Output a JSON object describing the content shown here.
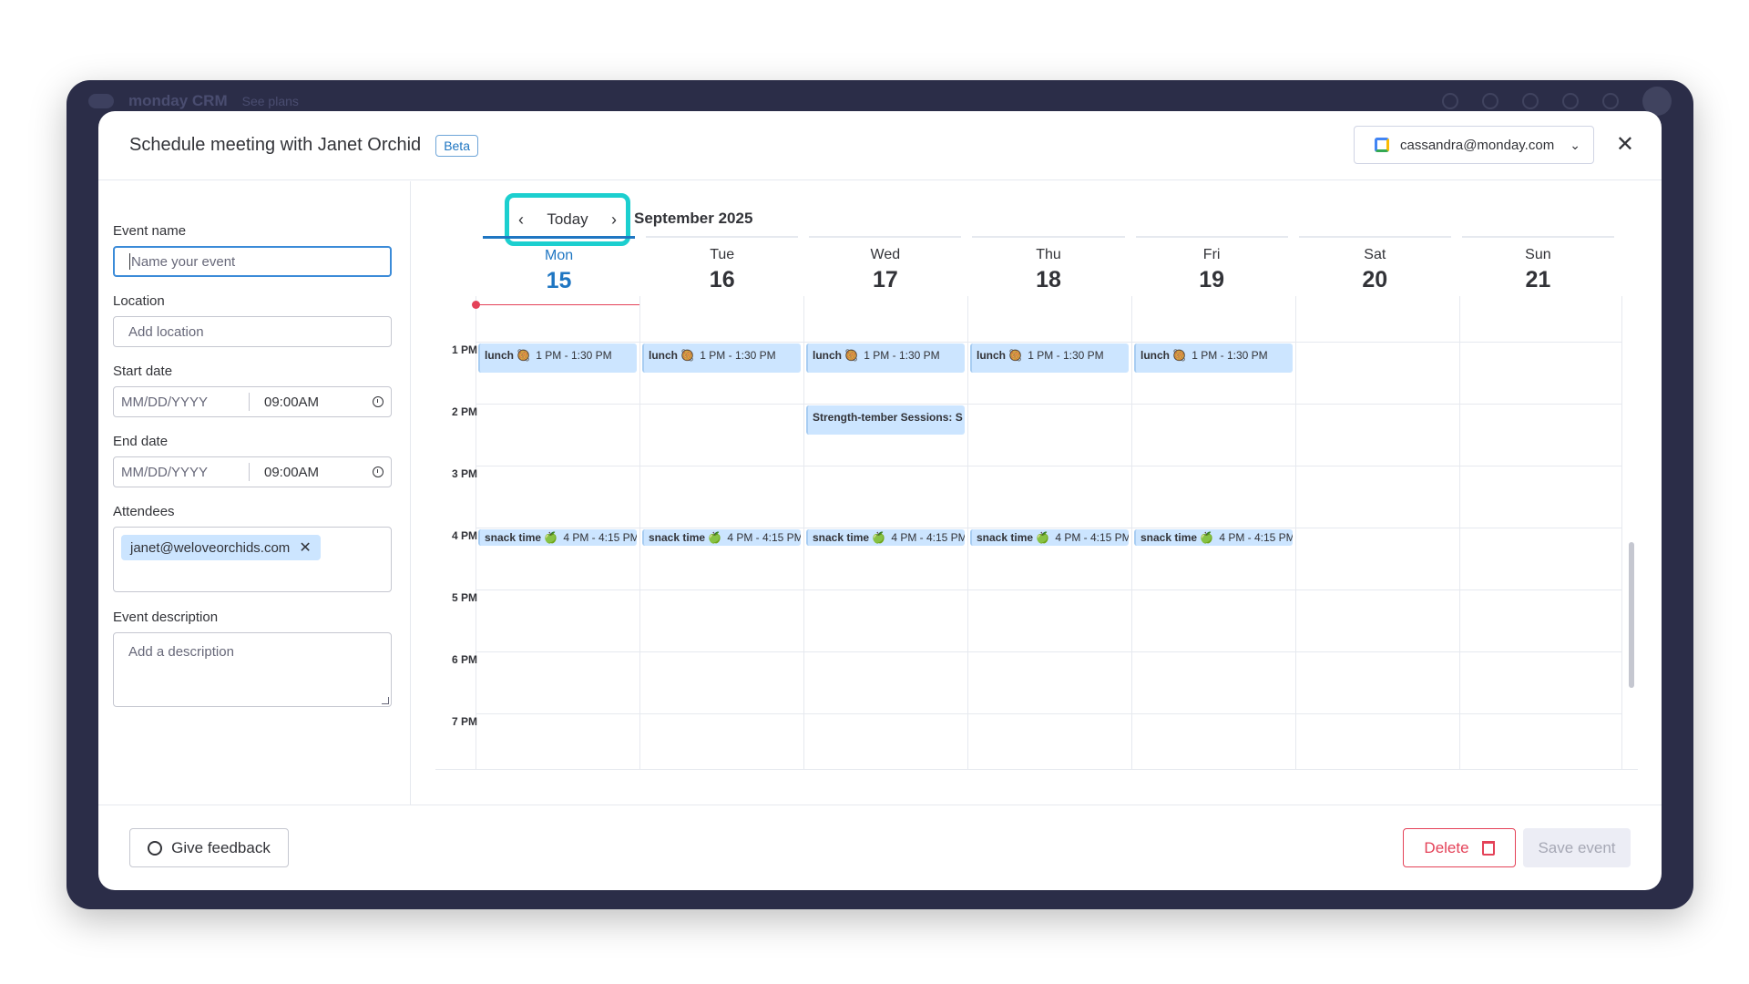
{
  "app": {
    "brand": "monday CRM",
    "see_plans": "See plans"
  },
  "modal": {
    "title": "Schedule meeting with Janet Orchid",
    "beta": "Beta",
    "account_email": "cassandra@monday.com",
    "close": "✕"
  },
  "form": {
    "event_name_label": "Event name",
    "event_name_placeholder": "Name your event",
    "location_label": "Location",
    "location_placeholder": "Add location",
    "start_date_label": "Start date",
    "start_date_placeholder": "MM/DD/YYYY",
    "start_time": "09:00AM",
    "end_date_label": "End date",
    "end_date_placeholder": "MM/DD/YYYY",
    "end_time": "09:00AM",
    "attendees_label": "Attendees",
    "attendee": "janet@weloveorchids.com",
    "description_label": "Event description",
    "description_placeholder": "Add a description"
  },
  "calendar": {
    "today": "Today",
    "month": "September 2025",
    "days": [
      {
        "name": "Mon",
        "num": "15"
      },
      {
        "name": "Tue",
        "num": "16"
      },
      {
        "name": "Wed",
        "num": "17"
      },
      {
        "name": "Thu",
        "num": "18"
      },
      {
        "name": "Fri",
        "num": "19"
      },
      {
        "name": "Sat",
        "num": "20"
      },
      {
        "name": "Sun",
        "num": "21"
      }
    ],
    "hours": [
      "1 PM",
      "2 PM",
      "3 PM",
      "4 PM",
      "5 PM",
      "6 PM",
      "7 PM"
    ],
    "lunch": {
      "title": "lunch 🥘",
      "time": "1 PM - 1:30 PM"
    },
    "snack": {
      "title": "snack time 🍏",
      "time": "4 PM - 4:15 PM"
    },
    "strength": {
      "title": "Strength-tember Sessions: S"
    }
  },
  "footer": {
    "feedback": "Give feedback",
    "delete": "Delete",
    "save": "Save event"
  },
  "colors": {
    "accent": "#1f76c2",
    "highlight": "#1ccfcf",
    "event_bg": "#cce5ff",
    "danger": "#e44258"
  }
}
